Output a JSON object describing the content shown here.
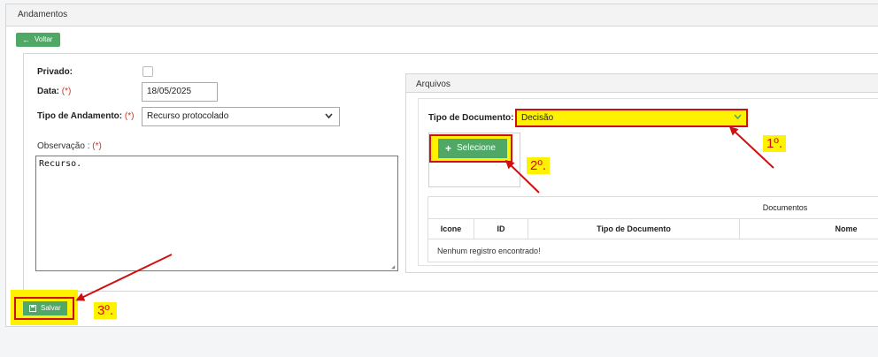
{
  "panel": {
    "title": "Andamentos"
  },
  "toolbar": {
    "back_label": "Voltar",
    "back_icon": "arrow-left-icon"
  },
  "form": {
    "privado_label": "Privado:",
    "data_label": "Data:",
    "data_value": "18/05/2025",
    "tipo_label": "Tipo de Andamento:",
    "tipo_value": "Recurso protocolado",
    "required_mark": "(*)",
    "obs_label": "Observação :",
    "obs_value": "Recurso."
  },
  "arquivos": {
    "title": "Arquivos",
    "tipo_doc_label": "Tipo de Documento:",
    "tipo_doc_value": "Decisão",
    "select_button": "Selecione",
    "select_icon": "plus-icon",
    "table": {
      "group_header": "Documentos",
      "columns": [
        "Icone",
        "ID",
        "Tipo de Documento",
        "Nome"
      ],
      "empty_message": "Nenhum registro encontrado!"
    }
  },
  "actions": {
    "save_label": "Salvar",
    "save_icon": "save-icon"
  },
  "annotations": {
    "step1": "1º.",
    "step2": "2º.",
    "step3": "3º."
  },
  "colors": {
    "green": "#4fa866",
    "highlight": "#fff200",
    "annotation_red": "#d01010"
  }
}
